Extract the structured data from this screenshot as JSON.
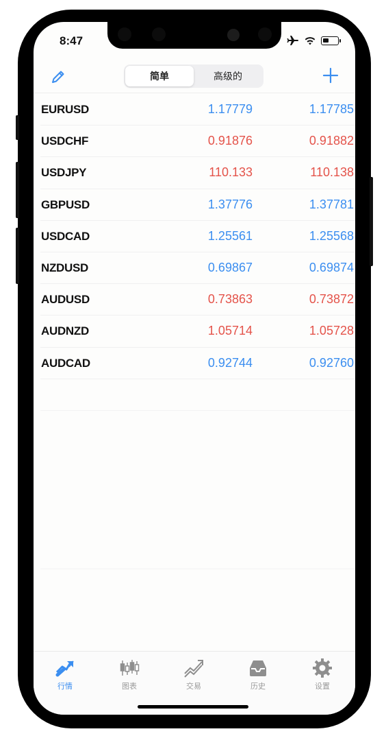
{
  "status": {
    "time": "8:47"
  },
  "nav": {
    "segments": [
      "简单",
      "高级的"
    ],
    "active_segment": 0
  },
  "colors": {
    "up": "#3b8ef0",
    "down": "#e4534a",
    "accent": "#3b8ef0"
  },
  "quotes": [
    {
      "symbol": "EURUSD",
      "bid": "1.17779",
      "ask": "1.17785",
      "direction": "up"
    },
    {
      "symbol": "USDCHF",
      "bid": "0.91876",
      "ask": "0.91882",
      "direction": "down"
    },
    {
      "symbol": "USDJPY",
      "bid": "110.133",
      "ask": "110.138",
      "direction": "down"
    },
    {
      "symbol": "GBPUSD",
      "bid": "1.37776",
      "ask": "1.37781",
      "direction": "up"
    },
    {
      "symbol": "USDCAD",
      "bid": "1.25561",
      "ask": "1.25568",
      "direction": "up"
    },
    {
      "symbol": "NZDUSD",
      "bid": "0.69867",
      "ask": "0.69874",
      "direction": "up"
    },
    {
      "symbol": "AUDUSD",
      "bid": "0.73863",
      "ask": "0.73872",
      "direction": "down"
    },
    {
      "symbol": "AUDNZD",
      "bid": "1.05714",
      "ask": "1.05728",
      "direction": "down"
    },
    {
      "symbol": "AUDCAD",
      "bid": "0.92744",
      "ask": "0.92760",
      "direction": "up"
    }
  ],
  "tabs": [
    {
      "label": "行情",
      "icon": "quotes-icon",
      "active": true
    },
    {
      "label": "图表",
      "icon": "chart-icon",
      "active": false
    },
    {
      "label": "交易",
      "icon": "trade-icon",
      "active": false
    },
    {
      "label": "历史",
      "icon": "history-icon",
      "active": false
    },
    {
      "label": "设置",
      "icon": "settings-icon",
      "active": false
    }
  ]
}
